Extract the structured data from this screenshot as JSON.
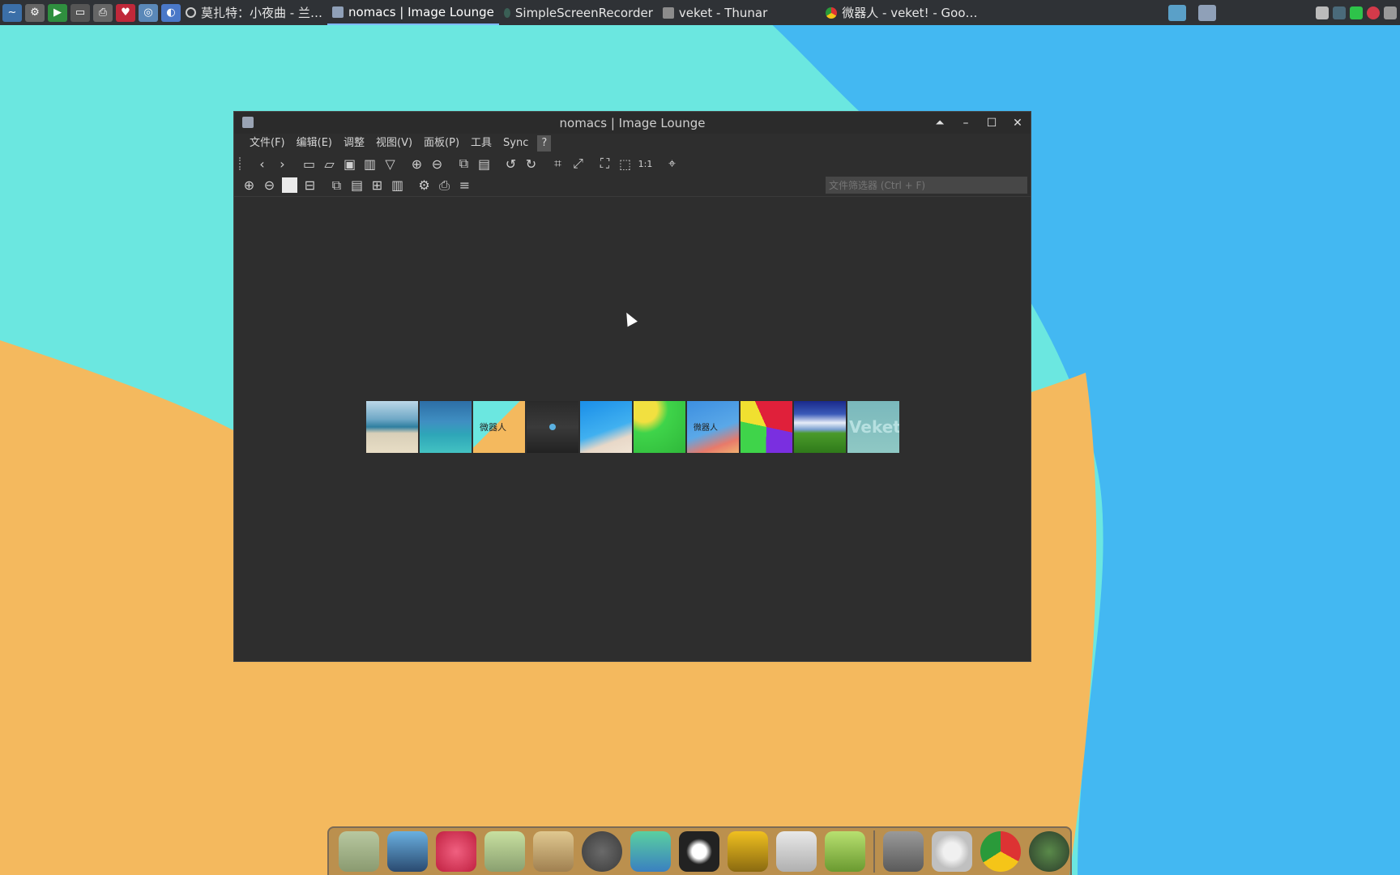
{
  "taskbar": {
    "tasks": [
      {
        "label": "莫扎特：小夜曲 - 兰…"
      },
      {
        "label": "nomacs | Image Lounge"
      },
      {
        "label": "SimpleScreenRecorder"
      },
      {
        "label": "veket - Thunar"
      },
      {
        "label": "微器人 - veket! - Goo…"
      }
    ]
  },
  "window": {
    "title": "nomacs | Image Lounge",
    "menu": [
      "文件(F)",
      "编辑(E)",
      "调整",
      "视图(V)",
      "面板(P)",
      "工具",
      "Sync",
      "?"
    ],
    "filter_placeholder": "文件筛选器 (Ctrl + F)",
    "thumbnails": [
      {
        "name": "beach"
      },
      {
        "name": "sea"
      },
      {
        "name": "weiqiren",
        "caption": "微器人"
      },
      {
        "name": "dark"
      },
      {
        "name": "blue-beach"
      },
      {
        "name": "green"
      },
      {
        "name": "weiqiren2",
        "caption": "微器人"
      },
      {
        "name": "colorful"
      },
      {
        "name": "grass"
      },
      {
        "name": "veket",
        "caption": "Veket"
      }
    ]
  },
  "colors": {
    "desktop_cyan": "#6be7e0",
    "desktop_blue": "#43b8f2",
    "desktop_orange": "#f4b95e"
  }
}
